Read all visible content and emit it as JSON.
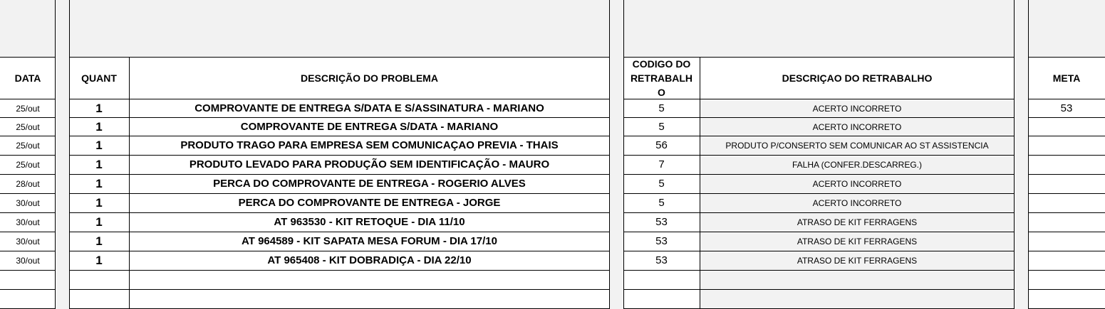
{
  "headers": {
    "data": "DATA",
    "quant": "QUANT",
    "problema": "DESCRIÇÃO DO PROBLEMA",
    "codigo": "CODIGO DO RETRABALH O",
    "retrabalho": "DESCRIÇAO DO RETRABALHO",
    "meta": "META"
  },
  "rows": [
    {
      "data": "25/out",
      "quant": "1",
      "problema": "COMPROVANTE DE ENTREGA S/DATA E S/ASSINATURA - MARIANO",
      "codigo": "5",
      "retrabalho": "ACERTO INCORRETO",
      "meta": "53"
    },
    {
      "data": "25/out",
      "quant": "1",
      "problema": "COMPROVANTE DE ENTREGA S/DATA - MARIANO",
      "codigo": "5",
      "retrabalho": "ACERTO INCORRETO",
      "meta": ""
    },
    {
      "data": "25/out",
      "quant": "1",
      "problema": "PRODUTO TRAGO PARA EMPRESA SEM COMUNICAÇAO PREVIA -  THAIS",
      "codigo": "56",
      "retrabalho": "PRODUTO P/CONSERTO SEM COMUNICAR AO ST ASSISTENCIA",
      "meta": ""
    },
    {
      "data": "25/out",
      "quant": "1",
      "problema": "PRODUTO LEVADO PARA PRODUÇÃO SEM IDENTIFICAÇÃO - MAURO",
      "codigo": "7",
      "retrabalho": "FALHA (CONFER.DESCARREG.)",
      "meta": ""
    },
    {
      "data": "28/out",
      "quant": "1",
      "problema": "PERCA DO COMPROVANTE DE ENTREGA - ROGERIO ALVES",
      "codigo": "5",
      "retrabalho": "ACERTO INCORRETO",
      "meta": ""
    },
    {
      "data": "30/out",
      "quant": "1",
      "problema": "PERCA DO COMPROVANTE DE ENTREGA - JORGE",
      "codigo": "5",
      "retrabalho": "ACERTO INCORRETO",
      "meta": ""
    },
    {
      "data": "30/out",
      "quant": "1",
      "problema": "AT 963530 - KIT RETOQUE - DIA 11/10",
      "codigo": "53",
      "retrabalho": "ATRASO DE KIT FERRAGENS",
      "meta": ""
    },
    {
      "data": "30/out",
      "quant": "1",
      "problema": "AT 964589 - KIT SAPATA MESA FORUM - DIA 17/10",
      "codigo": "53",
      "retrabalho": "ATRASO DE KIT FERRAGENS",
      "meta": ""
    },
    {
      "data": "30/out",
      "quant": "1",
      "problema": "AT 965408 - KIT DOBRADIÇA - DIA 22/10",
      "codigo": "53",
      "retrabalho": "ATRASO DE KIT FERRAGENS",
      "meta": ""
    },
    {
      "data": "",
      "quant": "",
      "problema": "",
      "codigo": "",
      "retrabalho": "",
      "meta": ""
    },
    {
      "data": "",
      "quant": "",
      "problema": "",
      "codigo": "",
      "retrabalho": "",
      "meta": ""
    }
  ]
}
